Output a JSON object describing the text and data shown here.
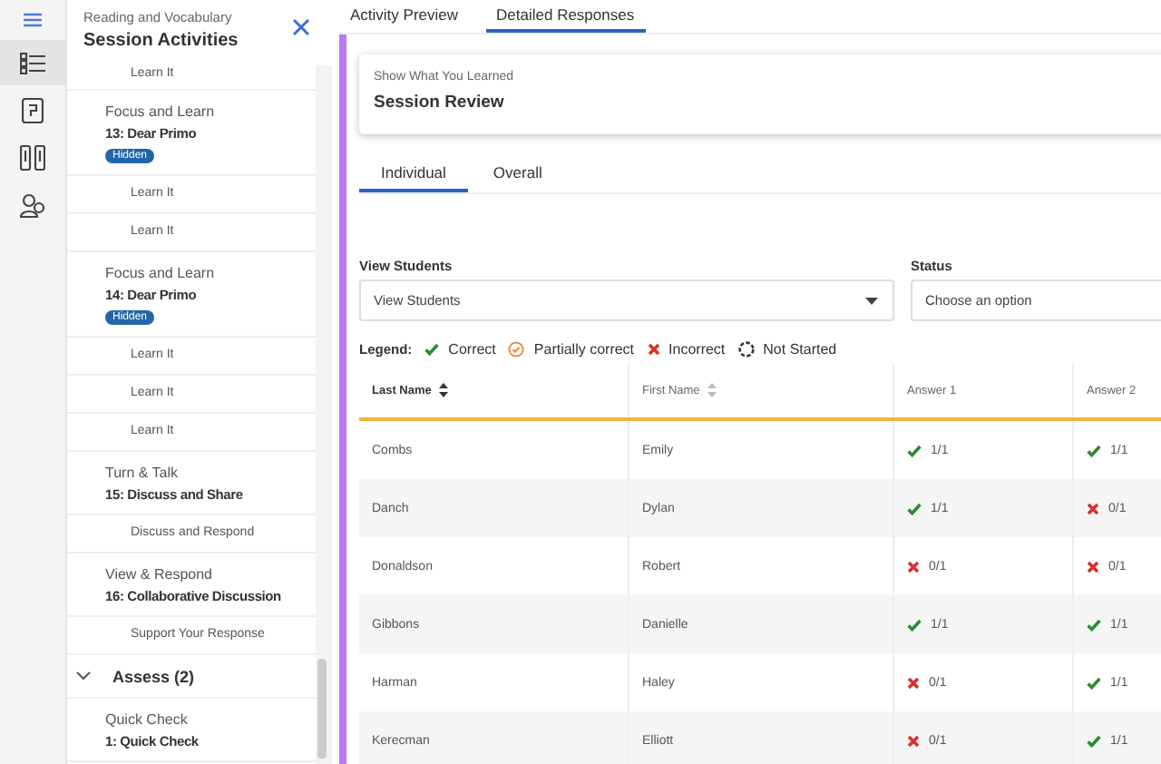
{
  "rail": [
    {
      "selected": true
    },
    {
      "selected": false
    },
    {
      "selected": false
    },
    {
      "selected": false
    }
  ],
  "sidebar": {
    "subtitle": "Reading and Vocabulary",
    "title": "Session Activities",
    "items": [
      {
        "kind": "activity",
        "label": "Learn It"
      },
      {
        "kind": "group",
        "category": "Focus and Learn",
        "title": "13: Dear Primo",
        "badge": "Hidden"
      },
      {
        "kind": "activity",
        "label": "Learn It"
      },
      {
        "kind": "activity",
        "label": "Learn It"
      },
      {
        "kind": "group",
        "category": "Focus and Learn",
        "title": "14: Dear Primo",
        "badge": "Hidden"
      },
      {
        "kind": "activity",
        "label": "Learn It"
      },
      {
        "kind": "activity",
        "label": "Learn It"
      },
      {
        "kind": "activity",
        "label": "Learn It"
      },
      {
        "kind": "group",
        "category": "Turn & Talk",
        "title": "15: Discuss and Share"
      },
      {
        "kind": "activity",
        "label": "Discuss and Respond"
      },
      {
        "kind": "group",
        "category": "View & Respond",
        "title": "16: Collaborative Discussion"
      },
      {
        "kind": "activity",
        "label": "Support Your Response"
      },
      {
        "kind": "section",
        "label": "Assess (2)",
        "expanded": true
      },
      {
        "kind": "group",
        "category": "Quick Check",
        "title": "1: Quick Check"
      }
    ]
  },
  "tabs": [
    {
      "label": "Activity Preview",
      "selected": false
    },
    {
      "label": "Detailed Responses",
      "selected": true
    }
  ],
  "card": {
    "category": "Show What You Learned",
    "title": "Session Review"
  },
  "view_tabs": [
    {
      "label": "Individual",
      "selected": true
    },
    {
      "label": "Overall",
      "selected": false
    }
  ],
  "filters": [
    {
      "label": "View Students",
      "value": "View Students"
    },
    {
      "label": "Status",
      "placeholder": "Choose an option"
    }
  ],
  "legend": {
    "label": "Legend:",
    "items": [
      {
        "kind": "correct",
        "label": "Correct"
      },
      {
        "kind": "partial",
        "label": "Partially correct"
      },
      {
        "kind": "incorrect",
        "label": "Incorrect"
      },
      {
        "kind": "not_started",
        "label": "Not Started"
      }
    ]
  },
  "table": {
    "columns": [
      {
        "label": "Last Name",
        "sortable": true,
        "sorted": true
      },
      {
        "label": "First Name",
        "sortable": true,
        "sorted": false
      },
      {
        "label": "Answer 1",
        "sortable": false,
        "sorted": false
      },
      {
        "label": "Answer 2",
        "sortable": false,
        "sorted": false
      }
    ],
    "rows": [
      {
        "last": "Combs",
        "first": "Emily",
        "answers": [
          {
            "kind": "correct",
            "score": "1/1"
          },
          {
            "kind": "correct",
            "score": "1/1"
          }
        ]
      },
      {
        "last": "Danch",
        "first": "Dylan",
        "answers": [
          {
            "kind": "correct",
            "score": "1/1"
          },
          {
            "kind": "incorrect",
            "score": "0/1"
          }
        ]
      },
      {
        "last": "Donaldson",
        "first": "Robert",
        "answers": [
          {
            "kind": "incorrect",
            "score": "0/1"
          },
          {
            "kind": "incorrect",
            "score": "0/1"
          }
        ]
      },
      {
        "last": "Gibbons",
        "first": "Danielle",
        "answers": [
          {
            "kind": "correct",
            "score": "1/1"
          },
          {
            "kind": "correct",
            "score": "1/1"
          }
        ]
      },
      {
        "last": "Harman",
        "first": "Haley",
        "answers": [
          {
            "kind": "incorrect",
            "score": "0/1"
          },
          {
            "kind": "correct",
            "score": "1/1"
          }
        ]
      },
      {
        "last": "Kerecman",
        "first": "Elliott",
        "answers": [
          {
            "kind": "incorrect",
            "score": "0/1"
          },
          {
            "kind": "correct",
            "score": "1/1"
          }
        ]
      }
    ]
  }
}
